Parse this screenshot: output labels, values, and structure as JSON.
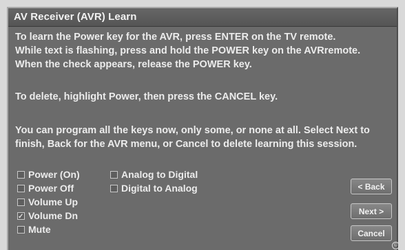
{
  "window": {
    "title": "AV Receiver (AVR) Learn"
  },
  "instructions": {
    "line1": "To learn the Power key for the AVR, press ENTER on the TV remote.",
    "line2": "While text is flashing, press and hold the POWER key on the AVRremote.",
    "line3": "When the check appears, release the POWER key.",
    "delete_line": "To delete, highlight Power, then press the CANCEL key.",
    "program_line1": "You can program all the keys now, only some, or none at all. Select Next to",
    "program_line2": "finish, Back for the AVR menu, or Cancel to delete learning this session."
  },
  "keys": {
    "column1": [
      {
        "label": "Power (On)",
        "checked": false
      },
      {
        "label": "Power Off",
        "checked": false
      },
      {
        "label": "Volume Up",
        "checked": false
      },
      {
        "label": "Volume Dn",
        "checked": true
      },
      {
        "label": "Mute",
        "checked": false
      }
    ],
    "column2": [
      {
        "label": "Analog to Digital",
        "checked": false
      },
      {
        "label": "Digital to Analog",
        "checked": false
      }
    ]
  },
  "buttons": {
    "back": "< Back",
    "next": "Next >",
    "cancel": "Cancel"
  },
  "footer": {
    "copyright_symbol": "©"
  }
}
